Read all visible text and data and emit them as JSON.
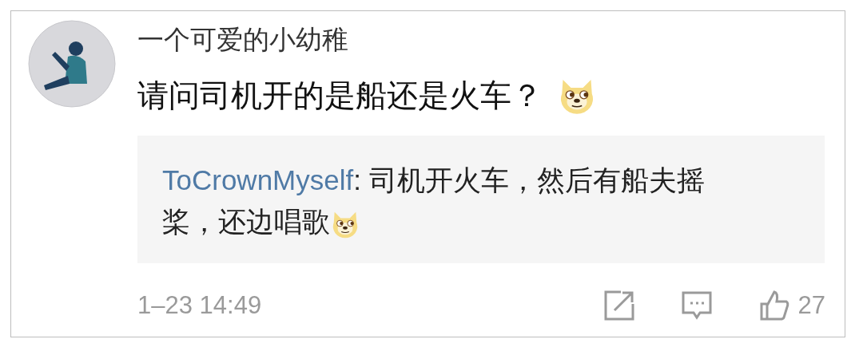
{
  "comment": {
    "author": "一个可爱的小幼稚",
    "text": "请问司机开的是船还是火车？",
    "emoji_after": true
  },
  "reply": {
    "author": "ToCrownMyself",
    "separator": ":",
    "text": "司机开火车，然后有船夫摇桨，还边唱歌",
    "emoji_after": true
  },
  "footer": {
    "time": "1–23 14:49",
    "likes": "27"
  }
}
